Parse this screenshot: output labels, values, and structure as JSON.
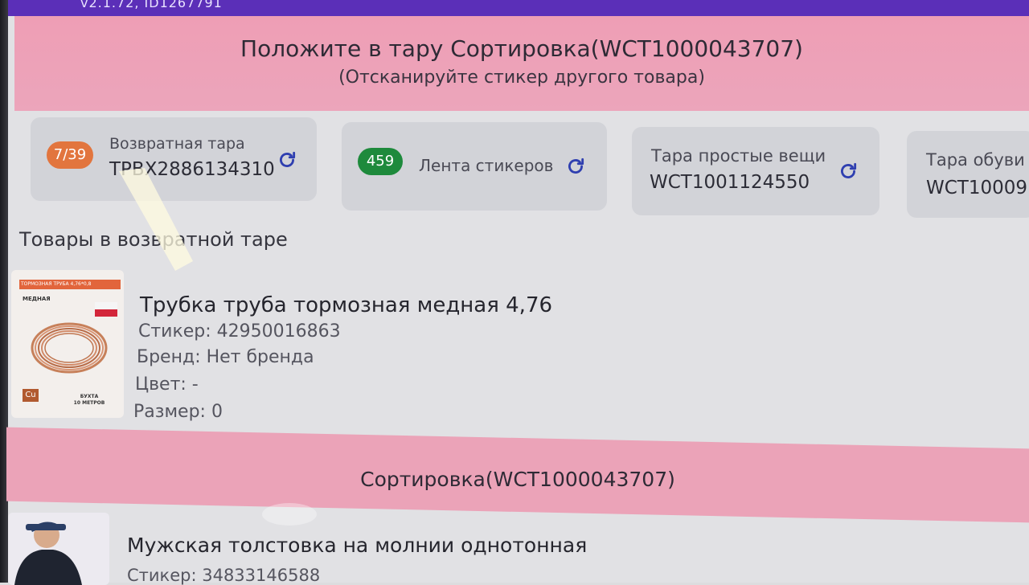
{
  "header": {
    "version_text": "v2.1.72, ID1267791"
  },
  "banner": {
    "title": "Положите в тару Сортировка(WCT1000043707)",
    "subtitle": "(Отсканируйте стикер другого товара)"
  },
  "cards": [
    {
      "badge": "7/39",
      "badge_color": "#e2753e",
      "label": "Возвратная тара",
      "value": "TPBX2886134310",
      "icon": "refresh-icon"
    },
    {
      "badge": "459",
      "badge_color": "#1e8a3c",
      "label": "Лента стикеров",
      "icon": "refresh-icon"
    },
    {
      "label": "Тара простые вещи",
      "value": "WCT1001124550",
      "icon": "refresh-icon"
    },
    {
      "label": "Тара обуви",
      "value": "WCT10009"
    }
  ],
  "section": {
    "title": "Товары в возвратной таре"
  },
  "product": {
    "title": "Трубка труба тормозная медная 4,76",
    "sticker": "Стикер: 42950016863",
    "brand": "Бренд: Нет бренда",
    "color": "Цвет: -",
    "size": "Размер: 0",
    "image": {
      "top_text": "ТОРМОЗНАЯ ТРУБА 4,76*0,8",
      "material": "МЕДНАЯ",
      "element": "Cu",
      "bottom_text_1": "БУХТА",
      "bottom_text_2": "10 МЕТРОВ"
    }
  },
  "sort_section": {
    "title": "Сортировка(WCT1000043707)"
  },
  "product2": {
    "title": "Мужская толстовка на молнии однотонная",
    "sticker": "Стикер: 34833146588"
  },
  "colors": {
    "accent_purple": "#5b2fb8",
    "banner_pink": "#eca5bb",
    "refresh_blue": "#2f3fb0"
  }
}
